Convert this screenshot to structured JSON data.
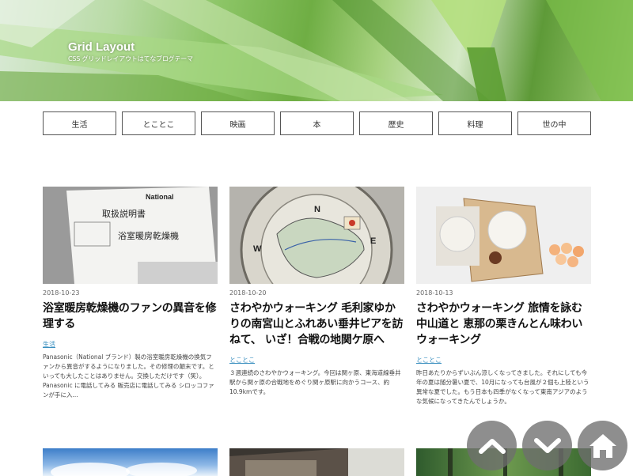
{
  "header": {
    "title": "Grid Layout",
    "tagline": "CSS グリッドレイアウトはてなブログテーマ"
  },
  "nav": {
    "items": [
      "生活",
      "とことこ",
      "映画",
      "本",
      "歴史",
      "料理",
      "世の中"
    ]
  },
  "posts": [
    {
      "date": "2018-10-23",
      "title": "浴室暖房乾燥機のファンの異音を修理する",
      "category": "生活",
      "excerpt": "Panasonic（National ブランド）製の浴室暖房乾燥機の換気ファンから異音がするようになりました。その修理の顛末です。といっても大したことはありません。交換しただけです（笑）。 Panasonic に電話してみる 販売店に電話してみる シロッコファンが手に入...",
      "image_text": {
        "brand": "National",
        "doc": "取扱説明書",
        "product": "浴室暖房乾燥機"
      }
    },
    {
      "date": "2018-10-20",
      "title": "さわやかウォーキング 毛利家ゆかりの南宮山とふれあい垂井ピアを訪ねて、 いざ！合戦の地関ケ原へ",
      "category": "とことこ",
      "excerpt": "３週連続のさわやかウォーキング。今回は関ヶ原、東海道線垂井駅から関ヶ原の合戦地をめぐり関ヶ原駅に向かうコース、約10.9kmです。",
      "image_text": {
        "n": "N",
        "w": "W",
        "e": "E"
      }
    },
    {
      "date": "2018-10-13",
      "title": "さわやかウォーキング 旅情を詠む中山道と 恵那の栗きんとん味わいウォーキング",
      "category": "とことこ",
      "excerpt": "昨日あたりからずいぶん涼しくなってきました。それにしても今年の夏は随分暑い夏で、10月になっても台風が２個も上陸という異常な夏でした。もう日本も四季がなくなって東南アジアのような気候になってきたんでしょうか。",
      "image_text": {}
    }
  ],
  "fabs": {
    "up": "chevron-up-icon",
    "down": "chevron-down-icon",
    "home": "home-icon"
  }
}
